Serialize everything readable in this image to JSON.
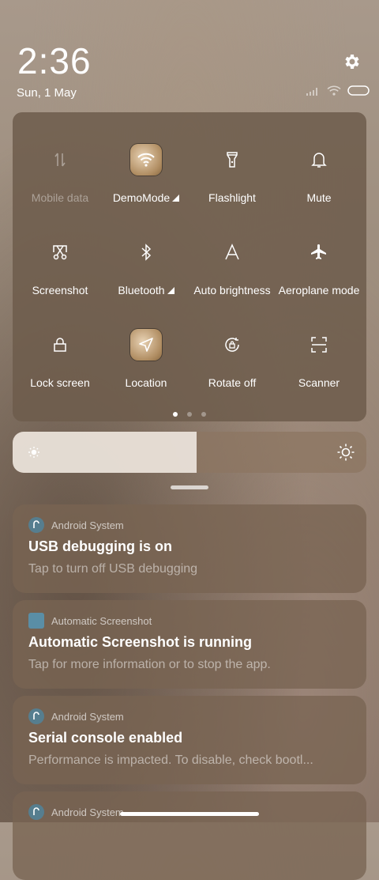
{
  "status": {
    "time": "2:36",
    "date": "Sun, 1 May",
    "icons": [
      "signal-icon",
      "wifi-icon",
      "battery-icon"
    ]
  },
  "settings_icon": "gear-icon",
  "quick_settings": {
    "tiles": [
      {
        "id": "mobile-data",
        "label": "Mobile data",
        "icon": "mobile-data-icon",
        "active": false,
        "disabled": true,
        "expand": false
      },
      {
        "id": "demomode",
        "label": "DemoMode",
        "icon": "wifi-icon",
        "active": true,
        "disabled": false,
        "expand": true
      },
      {
        "id": "flashlight",
        "label": "Flashlight",
        "icon": "flashlight-icon",
        "active": false,
        "disabled": false,
        "expand": false
      },
      {
        "id": "mute",
        "label": "Mute",
        "icon": "bell-icon",
        "active": false,
        "disabled": false,
        "expand": false
      },
      {
        "id": "screenshot",
        "label": "Screenshot",
        "icon": "screenshot-icon",
        "active": false,
        "disabled": false,
        "expand": false
      },
      {
        "id": "bluetooth",
        "label": "Bluetooth",
        "icon": "bluetooth-icon",
        "active": false,
        "disabled": false,
        "expand": true
      },
      {
        "id": "auto-brightness",
        "label": "Auto brightness",
        "icon": "auto-brightness-icon",
        "active": false,
        "disabled": false,
        "expand": false
      },
      {
        "id": "aeroplane-mode",
        "label": "Aeroplane mode",
        "icon": "airplane-icon",
        "active": false,
        "disabled": false,
        "expand": false
      },
      {
        "id": "lock-screen",
        "label": "Lock screen",
        "icon": "lock-icon",
        "active": false,
        "disabled": false,
        "expand": false
      },
      {
        "id": "location",
        "label": "Location",
        "icon": "location-icon",
        "active": true,
        "disabled": false,
        "expand": false
      },
      {
        "id": "rotate-off",
        "label": "Rotate off",
        "icon": "rotate-lock-icon",
        "active": false,
        "disabled": false,
        "expand": false
      },
      {
        "id": "scanner",
        "label": "Scanner",
        "icon": "scanner-icon",
        "active": false,
        "disabled": false,
        "expand": false
      }
    ],
    "page_count": 3,
    "current_page": 1
  },
  "brightness": {
    "level": 0.52,
    "low_icon": "brightness-low-icon",
    "high_icon": "brightness-high-icon"
  },
  "notifications": [
    {
      "app": "Android System",
      "app_icon": "android-system-icon",
      "title": "USB debugging is on",
      "body": "Tap to turn off USB debugging"
    },
    {
      "app": "Automatic Screenshot",
      "app_icon": "automatic-screenshot-icon",
      "title": "Automatic Screenshot is running",
      "body": "Tap for more information or to stop the app."
    },
    {
      "app": "Android System",
      "app_icon": "android-system-icon",
      "title": "Serial console enabled",
      "body": "Performance is impacted. To disable, check bootl..."
    },
    {
      "app": "Android System",
      "app_icon": "android-system-icon",
      "title": "",
      "body": ""
    }
  ]
}
